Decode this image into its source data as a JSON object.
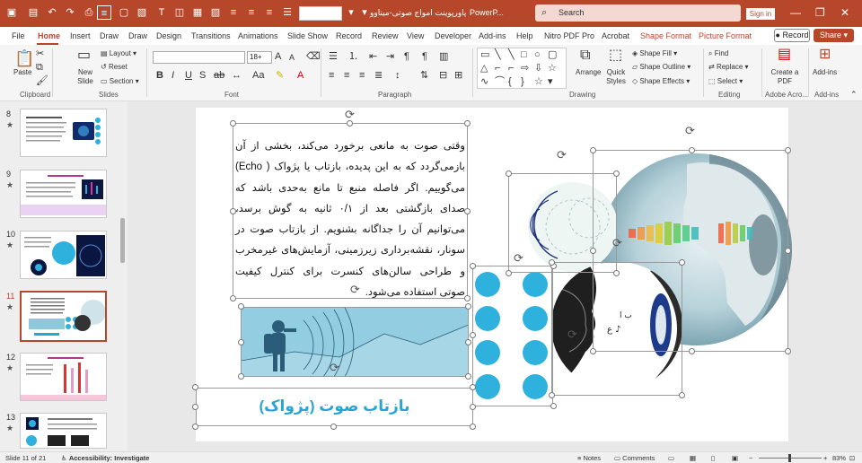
{
  "titlebar": {
    "doc_title": "پاورپوینت امواج صوتی-میناوو",
    "app_name": "PowerP...",
    "search_placeholder": "Search",
    "signin_label": "Sign in",
    "font_combo_value": ""
  },
  "menu": {
    "tabs": [
      "File",
      "Home",
      "Insert",
      "Draw",
      "Draw",
      "Design",
      "Transitions",
      "Animations",
      "Slide Show",
      "Record",
      "Review",
      "View",
      "Developer",
      "Add-ins",
      "Help",
      "Nitro PDF Pro",
      "Acrobat",
      "Shape Format",
      "Picture Format"
    ],
    "record_label": "Record",
    "share_label": "Share"
  },
  "ribbon": {
    "clipboard": {
      "paste": "Paste",
      "label": "Clipboard"
    },
    "slides": {
      "new_slide": "New Slide",
      "layout": "Layout",
      "reset": "Reset",
      "section": "Section",
      "label": "Slides"
    },
    "font": {
      "size": "18+",
      "label": "Font"
    },
    "paragraph": {
      "label": "Paragraph"
    },
    "drawing": {
      "arrange": "Arrange",
      "quick_styles": "Quick Styles",
      "shape_fill": "Shape Fill",
      "shape_outline": "Shape Outline",
      "shape_effects": "Shape Effects",
      "label": "Drawing"
    },
    "editing": {
      "find": "Find",
      "replace": "Replace",
      "select": "Select",
      "label": "Editing"
    },
    "acrobat": {
      "create_pdf": "Create a PDF",
      "label": "Adobe Acro..."
    },
    "addins": {
      "addins": "Add-ins",
      "label": "Add-ins"
    }
  },
  "thumbnails": [
    {
      "num": "8"
    },
    {
      "num": "9"
    },
    {
      "num": "10"
    },
    {
      "num": "11"
    },
    {
      "num": "12"
    },
    {
      "num": "13"
    }
  ],
  "slide": {
    "body_lines": [
      "وقتی صوت به مانعی برخورد می‌کند، بخشی از آن",
      "بازمی‌گردد که به این پدیده، بازتاب یا پژواک ( Echo)",
      "می‌گوییم. اگر فاصله منبع تا مانع به‌حدی باشد که",
      "صدای بازگشتی بعد از ۰/۱ ثانیه به گوش برسد،",
      "می‌توانیم آن را جداگانه بشنویم. از بازتاب صوت در",
      "سونار، نقشه‌برداری زیرزمینی، آزمایش‌های غیرمخرب",
      "و طراحی سالن‌های کنسرت برای کنترل کیفیت",
      "صوتی استفاده می‌شود."
    ],
    "heading": "بازتاب صوت (پژواک)"
  },
  "status": {
    "slide_info": "Slide 11 of 21",
    "accessibility": "Accessibility: Investigate",
    "notes": "Notes",
    "comments": "Comments",
    "zoom": "83%"
  },
  "colors": {
    "accent": "#b7472a",
    "heading": "#29a5d5",
    "dots": "#2fb1de"
  }
}
